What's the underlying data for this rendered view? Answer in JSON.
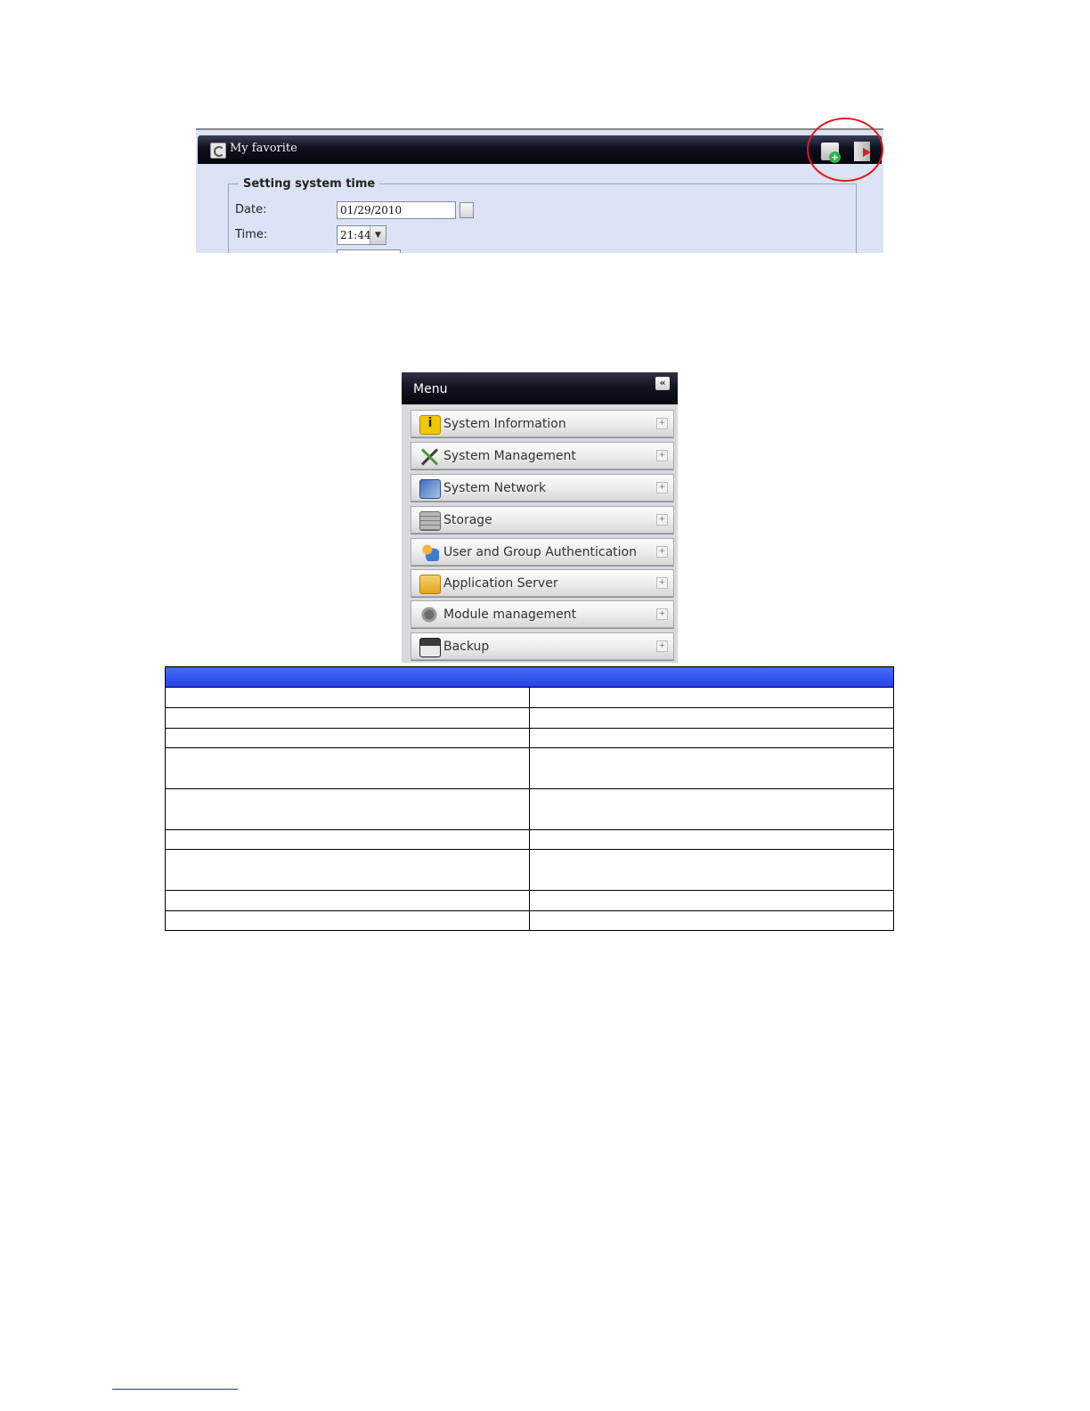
{
  "favorite_panel": {
    "title": "My favorite",
    "icons": [
      "add-favorite-icon",
      "logout-icon"
    ],
    "highlight_color": "#e01818",
    "section_title": "Setting system time",
    "date_label": "Date:",
    "date_value": "01/29/2010",
    "time_label": "Time:",
    "time_value": "21:44"
  },
  "menu": {
    "title": "Menu",
    "collapse_glyph": "«",
    "items": [
      {
        "label": "System Information",
        "icon": "info-icon"
      },
      {
        "label": "System Management",
        "icon": "tools-icon"
      },
      {
        "label": "System Network",
        "icon": "network-icon"
      },
      {
        "label": "Storage",
        "icon": "storage-icon"
      },
      {
        "label": "User and Group Authentication",
        "icon": "users-icon"
      },
      {
        "label": "Application Server",
        "icon": "folder-icon"
      },
      {
        "label": "Module management",
        "icon": "gear-icon"
      },
      {
        "label": "Backup",
        "icon": "backup-icon"
      }
    ]
  },
  "table": {
    "header_color": "#2a4af0",
    "rows": 11
  }
}
